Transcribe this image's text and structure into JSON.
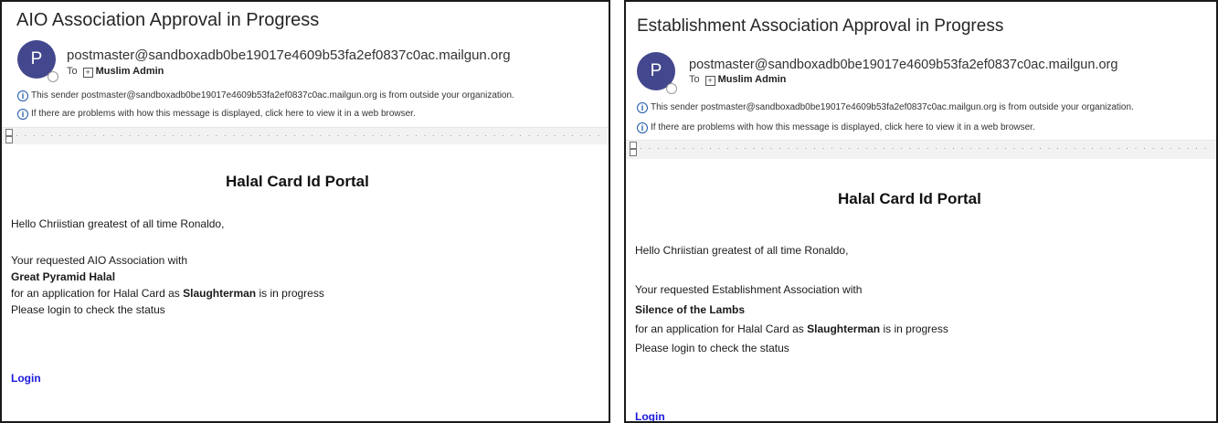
{
  "emails": [
    {
      "subject": "AIO Association Approval in Progress",
      "avatar_initial": "P",
      "sender": "postmaster@sandboxadb0be19017e4609b53fa2ef0837c0ac.mailgun.org",
      "to_label": "To",
      "recipient": "Muslim Admin",
      "info_outside": "This sender postmaster@sandboxadb0be19017e4609b53fa2ef0837c0ac.mailgun.org is from outside your organization.",
      "info_browser": "If there are problems with how this message is displayed, click here to view it in a web browser.",
      "portal_title": "Halal Card Id Portal",
      "greeting": "Hello Chriistian greatest of all time Ronaldo,",
      "line_requested": "Your requested AIO Association with",
      "association_name": "Great Pyramid Halal",
      "line_app_prefix": "for an application for Halal Card as",
      "role": "Slaughterman",
      "line_app_suffix": "is in progress",
      "line_login": "Please login to check the status",
      "login_link": "Login"
    },
    {
      "subject": "Establishment Association Approval in Progress",
      "avatar_initial": "P",
      "sender": "postmaster@sandboxadb0be19017e4609b53fa2ef0837c0ac.mailgun.org",
      "to_label": "To",
      "recipient": "Muslim Admin",
      "info_outside": "This sender postmaster@sandboxadb0be19017e4609b53fa2ef0837c0ac.mailgun.org is from outside your organization.",
      "info_browser": "If there are problems with how this message is displayed, click here to view it in a web browser.",
      "portal_title": "Halal Card Id Portal",
      "greeting": "Hello Chriistian greatest of all time Ronaldo,",
      "line_requested": "Your requested Establishment Association with",
      "association_name": "Silence of the Lambs",
      "line_app_prefix": "for an application for Halal Card as",
      "role": "Slaughterman",
      "line_app_suffix": "is in progress",
      "line_login": "Please login to check the status",
      "login_link": "Login"
    }
  ],
  "colors": {
    "avatar": "#43478d",
    "link": "#1a1adb",
    "info_icon": "#1e5aa8",
    "ruler": "#f2f2f2"
  },
  "icons": {
    "info": "info-icon",
    "expand": "expand-plus-icon"
  }
}
